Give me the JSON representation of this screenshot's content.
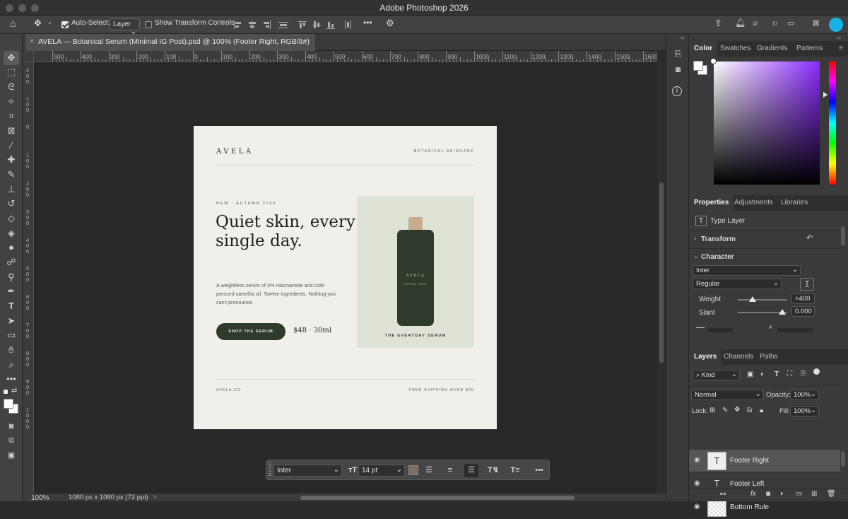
{
  "window": {
    "title": "Adobe Photoshop 2026"
  },
  "options_bar": {
    "auto_select_label": "Auto-Select:",
    "auto_select_target": "Layer",
    "show_transform_label": "Show Transform Controls",
    "more": "•••"
  },
  "document": {
    "tab_title": "AVELA — Botanical Serum (Minimal IG Post).psd @ 100% (Footer Right, RGB/8#)",
    "close": "×",
    "zoom": "100%",
    "doc_info": "1080 px x 1080 px (72 ppi)"
  },
  "ruler": {
    "h_labels": [
      "500",
      "400",
      "300",
      "200",
      "100",
      "0",
      "100",
      "200",
      "300",
      "400",
      "500",
      "600",
      "700",
      "800",
      "900",
      "1000",
      "1100",
      "1200",
      "1300",
      "1400",
      "1500",
      "1600"
    ],
    "v_labels": [
      "200",
      "100",
      "0",
      "100",
      "200",
      "300",
      "400",
      "500",
      "600",
      "700",
      "800",
      "900",
      "1000"
    ]
  },
  "artboard": {
    "brand": "AVELA",
    "brand_tag": "BOTANICAL SKINCARE",
    "eyebrow": "NEW · AUTUMN 2026",
    "headline": "Quiet skin, every single day.",
    "body": "A weightless serum of 3% niacinamide and cold-pressed camellia oil. Twelve ingredients. Nothing you can't pronounce.",
    "cta": "SHOP THE SERUM",
    "price": "$48 · 30ml",
    "bottle_brand": "AVELA",
    "bottle_sub": "SERUM 30ML",
    "card_caption": "THE EVERYDAY SERUM",
    "footer_left": "AVELA.CO",
    "footer_right": "FREE SHIPPING OVER $60",
    "colors": {
      "background": "#f1efe9",
      "bottle": "#2e3b2c",
      "card": "#dfe3d6",
      "cap": "#c7ad8e"
    }
  },
  "context_bar": {
    "font": "Inter",
    "size": "14 pt",
    "swatch": "#7a6f60",
    "icons": [
      "align-left-icon",
      "align-center-icon",
      "align-right-icon",
      "warp-text-icon",
      "text-panel-icon",
      "more-icon"
    ]
  },
  "color_panel": {
    "tabs": [
      "Color",
      "Swatches",
      "Gradients",
      "Patterns"
    ],
    "active_tab": "Color"
  },
  "properties_panel": {
    "tabs": [
      "Properties",
      "Adjustments",
      "Libraries"
    ],
    "layer_type": "Type Layer",
    "transform_label": "Transform",
    "character_label": "Character",
    "font_family": "Inter",
    "font_style": "Regular",
    "weight_label": "Weight",
    "weight_value": "+400",
    "weight_level": 0.3,
    "slant_label": "Slant",
    "slant_value": "0.000",
    "slant_level": 0.9
  },
  "layers_panel": {
    "tabs": [
      "Layers",
      "Channels",
      "Paths"
    ],
    "kind_filter": "Kind",
    "blend_mode": "Normal",
    "opacity_label": "Opacity:",
    "opacity": "100%",
    "lock_label": "Lock:",
    "fill_label": "Fill:",
    "fill": "100%",
    "layers": [
      {
        "name": "Footer Right",
        "kind": "type",
        "selected": true
      },
      {
        "name": "Footer Left",
        "kind": "type",
        "selected": false
      },
      {
        "name": "Bottom Rule",
        "kind": "pixel",
        "selected": false
      }
    ]
  }
}
